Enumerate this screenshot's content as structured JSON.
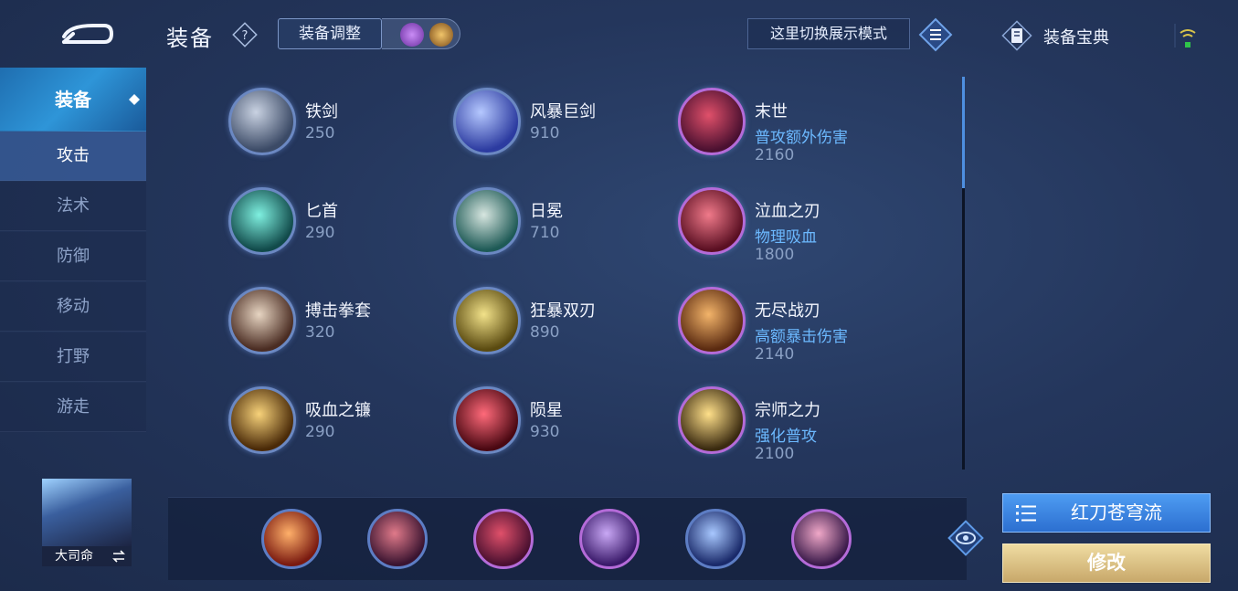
{
  "header": {
    "title": "装备",
    "adjust_label": "装备调整",
    "mode_switch_label": "这里切换展示模式",
    "codex_label": "装备宝典"
  },
  "sidebar": {
    "items": [
      {
        "label": "装备"
      },
      {
        "label": "攻击"
      },
      {
        "label": "法术"
      },
      {
        "label": "防御"
      },
      {
        "label": "移动"
      },
      {
        "label": "打野"
      },
      {
        "label": "游走"
      }
    ],
    "active": "攻击"
  },
  "hero": {
    "name": "大司命"
  },
  "items": [
    {
      "name": "铁剑",
      "price": "250",
      "color": "#7f8ea8"
    },
    {
      "name": "风暴巨剑",
      "price": "910",
      "color": "#4b63d6"
    },
    {
      "name": "末世",
      "tag": "普攻额外伤害",
      "price": "2160",
      "color": "#a52d4a"
    },
    {
      "name": "匕首",
      "price": "290",
      "color": "#2ea7a0"
    },
    {
      "name": "日冕",
      "price": "710",
      "color": "#3d8a7e"
    },
    {
      "name": "泣血之刃",
      "tag": "物理吸血",
      "price": "1800",
      "color": "#9e2035"
    },
    {
      "name": "搏击拳套",
      "price": "320",
      "color": "#8b6a55"
    },
    {
      "name": "狂暴双刃",
      "price": "890",
      "color": "#b59a2c"
    },
    {
      "name": "无尽战刃",
      "tag": "高额暴击伤害",
      "price": "2140",
      "color": "#b8682a"
    },
    {
      "name": "吸血之镰",
      "price": "290",
      "color": "#b8862a"
    },
    {
      "name": "陨星",
      "price": "930",
      "color": "#c9263b"
    },
    {
      "name": "宗师之力",
      "tag": "强化普攻",
      "price": "2100",
      "color": "#c9a237"
    }
  ],
  "build": {
    "plan_name": "红刀苍穹流",
    "edit_label": "修改",
    "slots": [
      "#cf4a2d",
      "#b23248",
      "#a92a45",
      "#7c4ec4",
      "#3c6fd6",
      "#8a3ca8"
    ]
  },
  "colors": {
    "accent": "#4e9cf2",
    "tag": "#6cb9ff",
    "gold": "#d9bd7e"
  }
}
